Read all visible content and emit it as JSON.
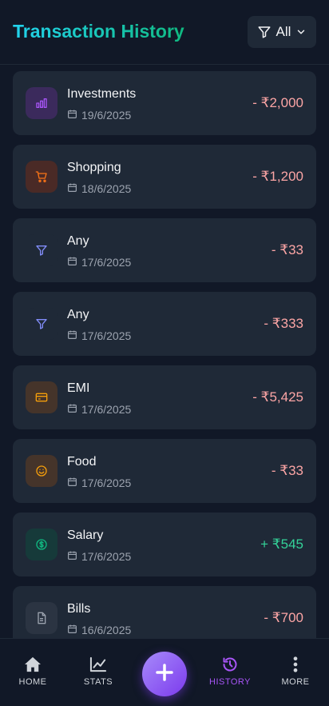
{
  "header": {
    "title": "Transaction History",
    "filter_label": "All"
  },
  "transactions": [
    {
      "category": "Investments",
      "date": "19/6/2025",
      "amount": "- ₹2,000",
      "icon": "bar-chart-icon",
      "icon_color": "#a855f7",
      "icon_bg": "#3b2a5c",
      "amount_color": "#fca5a5"
    },
    {
      "category": "Shopping",
      "date": "18/6/2025",
      "amount": "- ₹1,200",
      "icon": "cart-icon",
      "icon_color": "#f97316",
      "icon_bg": "#4a2a26",
      "amount_color": "#fca5a5"
    },
    {
      "category": "Any",
      "date": "17/6/2025",
      "amount": "- ₹33",
      "icon": "filter-icon",
      "icon_color": "#818cf8",
      "icon_bg": "#1f2937",
      "amount_color": "#fca5a5"
    },
    {
      "category": "Any",
      "date": "17/6/2025",
      "amount": "- ₹333",
      "icon": "filter-icon",
      "icon_color": "#818cf8",
      "icon_bg": "#1f2937",
      "amount_color": "#fca5a5"
    },
    {
      "category": "EMI",
      "date": "17/6/2025",
      "amount": "- ₹5,425",
      "icon": "credit-card-icon",
      "icon_color": "#f59e0b",
      "icon_bg": "#45342a",
      "amount_color": "#fca5a5"
    },
    {
      "category": "Food",
      "date": "17/6/2025",
      "amount": "- ₹33",
      "icon": "smile-icon",
      "icon_color": "#f59e0b",
      "icon_bg": "#45342a",
      "amount_color": "#fca5a5"
    },
    {
      "category": "Salary",
      "date": "17/6/2025",
      "amount": "+ ₹545",
      "icon": "dollar-circle-icon",
      "icon_color": "#10b981",
      "icon_bg": "#163a3a",
      "amount_color": "#34d399"
    },
    {
      "category": "Bills",
      "date": "16/6/2025",
      "amount": "- ₹700",
      "icon": "document-icon",
      "icon_color": "#9ca3af",
      "icon_bg": "#2b3442",
      "amount_color": "#fca5a5"
    }
  ],
  "nav": {
    "home": "HOME",
    "stats": "STATS",
    "history": "HISTORY",
    "more": "MORE",
    "active": "history",
    "active_color": "#a855f7"
  }
}
